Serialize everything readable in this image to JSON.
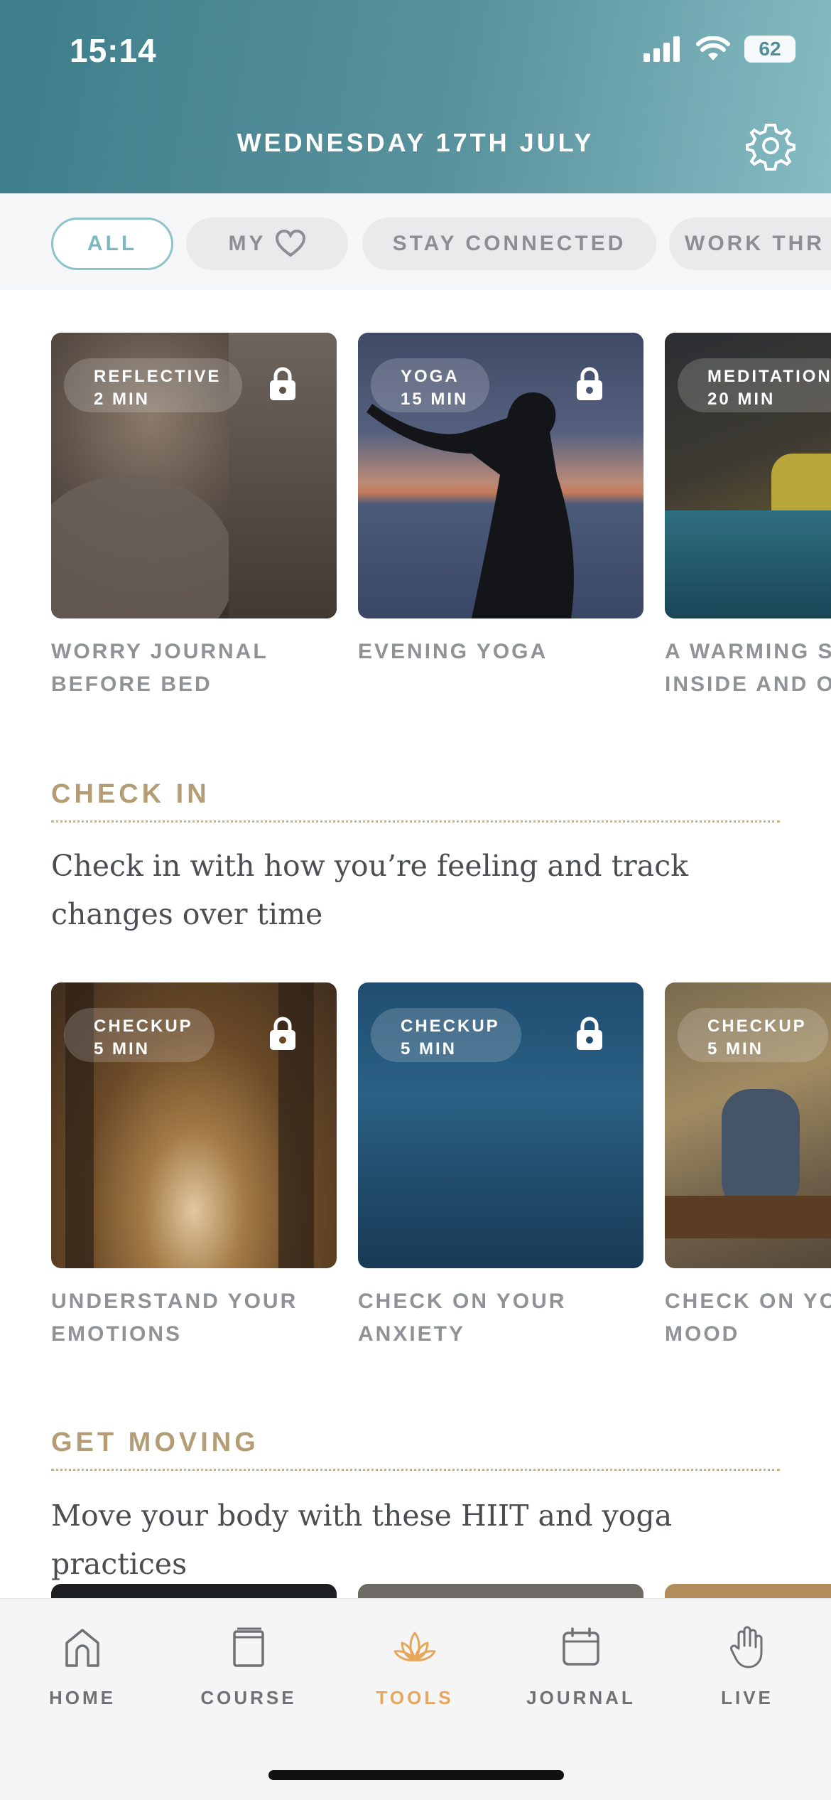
{
  "status_bar": {
    "time": "15:14",
    "battery": "62"
  },
  "header": {
    "title": "WEDNESDAY 17TH JULY"
  },
  "filters": [
    {
      "label": "ALL",
      "active": true
    },
    {
      "label": "MY",
      "has_heart": true
    },
    {
      "label": "STAY CONNECTED"
    },
    {
      "label": "WORK THR"
    }
  ],
  "featured": [
    {
      "type": "REFLECTIVE",
      "duration": "2 MIN",
      "title_line1": "WORRY JOURNAL",
      "title_line2": "BEFORE BED",
      "locked": true,
      "image": "person-sleeping"
    },
    {
      "type": "YOGA",
      "duration": "15 MIN",
      "title_line1": "EVENING YOGA",
      "title_line2": "",
      "locked": true,
      "image": "yoga-silhouette-sunset"
    },
    {
      "type": "MEDITATION",
      "duration": "20 MIN",
      "title_line1": "A WARMING S",
      "title_line2": "INSIDE AND O",
      "locked": false,
      "image": "cozy-bedroom"
    }
  ],
  "check_in": {
    "heading": "CHECK IN",
    "description": "Check in with how you’re feeling and track changes over time",
    "cards": [
      {
        "type": "CHECKUP",
        "duration": "5 MIN",
        "title_line1": "UNDERSTAND YOUR",
        "title_line2": "EMOTIONS",
        "locked": true,
        "image": "autumn-forest-path"
      },
      {
        "type": "CHECKUP",
        "duration": "5 MIN",
        "title_line1": "CHECK ON YOUR",
        "title_line2": "ANXIETY",
        "locked": true,
        "image": "underwater"
      },
      {
        "type": "CHECKUP",
        "duration": "5 MIN",
        "title_line1": "CHECK ON YO",
        "title_line2": "MOOD",
        "locked": false,
        "image": "woman-on-bench"
      }
    ]
  },
  "get_moving": {
    "heading": "GET MOVING",
    "description": "Move your body with these HIIT and yoga practices"
  },
  "bottom_nav": [
    {
      "label": "HOME",
      "icon": "home-icon"
    },
    {
      "label": "COURSE",
      "icon": "book-icon"
    },
    {
      "label": "TOOLS",
      "icon": "lotus-icon",
      "active": true
    },
    {
      "label": "JOURNAL",
      "icon": "calendar-icon"
    },
    {
      "label": "LIVE",
      "icon": "hand-icon"
    }
  ],
  "colors": {
    "header": "#4d8e98",
    "accent": "#7db8bf",
    "section": "#b49d74",
    "active_tab": "#e6a65c"
  }
}
